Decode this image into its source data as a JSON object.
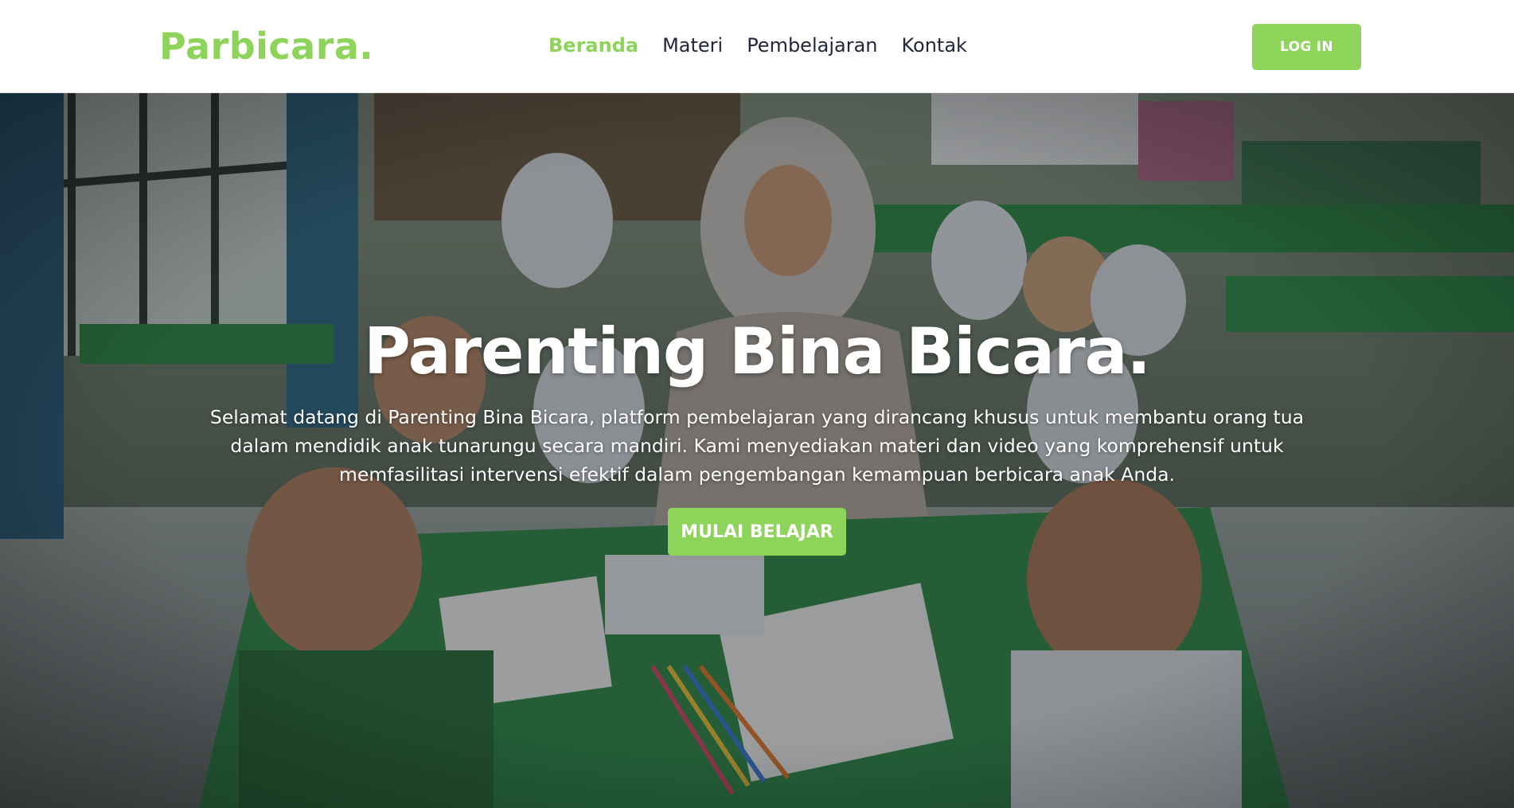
{
  "header": {
    "brand": "Parbicara.",
    "nav": [
      {
        "label": "Beranda",
        "active": true
      },
      {
        "label": "Materi",
        "active": false
      },
      {
        "label": "Pembelajaran",
        "active": false
      },
      {
        "label": "Kontak",
        "active": false
      }
    ],
    "login_label": "LOG IN"
  },
  "hero": {
    "title": "Parenting Bina Bicara.",
    "description": "Selamat datang di Parenting Bina Bicara, platform pembelajaran yang dirancang khusus untuk membantu orang tua dalam mendidik anak tunarungu secara mandiri. Kami menyediakan materi dan video yang komprehensif untuk memfasilitasi intervensi efektif dalam pengembangan kemampuan berbicara anak Anda.",
    "cta_label": "MULAI BELAJAR",
    "background_image": "classroom-photo"
  },
  "colors": {
    "accent": "#8ed45a",
    "nav_text": "#23263a",
    "hero_text": "#ffffff"
  }
}
